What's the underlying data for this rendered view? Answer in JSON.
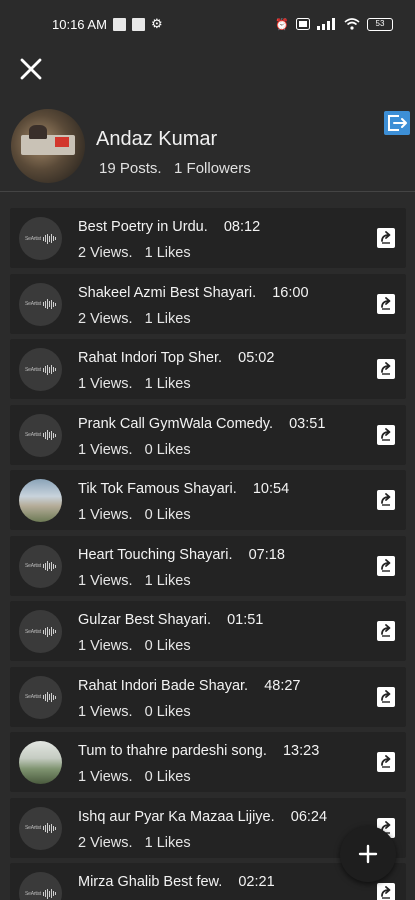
{
  "status_bar": {
    "time": "10:16 AM",
    "battery": "53"
  },
  "profile": {
    "name": "Andaz Kumar",
    "stats": "19 Posts.   1 Followers"
  },
  "posts": [
    {
      "title": "Best Poetry in Urdu.    08:12",
      "meta": "2 Views.   1 Likes",
      "thumb": "logo"
    },
    {
      "title": "Shakeel Azmi Best Shayari.    16:00",
      "meta": "2 Views.   1 Likes",
      "thumb": "logo"
    },
    {
      "title": "Rahat Indori Top Sher.    05:02",
      "meta": "1 Views.   1 Likes",
      "thumb": "logo"
    },
    {
      "title": "Prank Call GymWala Comedy.    03:51",
      "meta": "1 Views.   0 Likes",
      "thumb": "logo"
    },
    {
      "title": "Tik Tok Famous Shayari.    10:54",
      "meta": "1 Views.   0 Likes",
      "thumb": "photo"
    },
    {
      "title": "Heart Touching Shayari.    07:18",
      "meta": "1 Views.   1 Likes",
      "thumb": "logo"
    },
    {
      "title": "Gulzar Best Shayari.    01:51",
      "meta": "1 Views.   0 Likes",
      "thumb": "logo"
    },
    {
      "title": "Rahat Indori Bade Shayar.    48:27",
      "meta": "1 Views.   0 Likes",
      "thumb": "logo"
    },
    {
      "title": "Tum to thahre pardeshi song.    13:23",
      "meta": "1 Views.   0 Likes",
      "thumb": "photo2"
    },
    {
      "title": "Ishq aur Pyar Ka Mazaa Lijiye.    06:24",
      "meta": "2 Views.   1 Likes",
      "thumb": "logo"
    },
    {
      "title": "Mirza Ghalib Best few.    02:21",
      "meta": "",
      "thumb": "logo"
    }
  ],
  "thumb_logo_text": "SeArtist",
  "icons": {
    "close": "close-icon",
    "logout": "logout-icon",
    "share": "share-icon",
    "add": "add-icon"
  },
  "colors": {
    "background": "#2b2b2b",
    "row": "#232323",
    "accent_logout": "#3d8fd6"
  }
}
